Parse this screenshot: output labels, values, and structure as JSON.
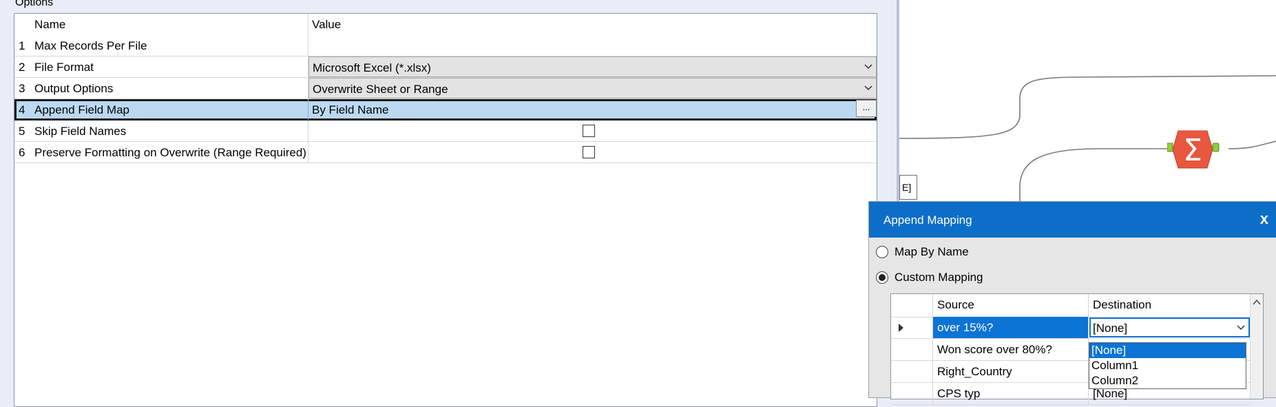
{
  "options": {
    "label": "Options",
    "header": {
      "name": "Name",
      "value": "Value"
    },
    "rows": [
      {
        "index": "1",
        "name": "Max Records Per File",
        "value": ""
      },
      {
        "index": "2",
        "name": "File Format",
        "value": "Microsoft Excel (*.xlsx)"
      },
      {
        "index": "3",
        "name": "Output Options",
        "value": "Overwrite Sheet or Range"
      },
      {
        "index": "4",
        "name": "Append Field Map",
        "value": "By Field Name",
        "button": "..."
      },
      {
        "index": "5",
        "name": "Skip Field Names",
        "checked": false
      },
      {
        "index": "6",
        "name": "Preserve Formatting on Overwrite (Range Required)",
        "checked": false
      }
    ]
  },
  "canvas": {
    "tool_box_text": "E]"
  },
  "append_mapping": {
    "title": "Append Mapping",
    "close_label": "x",
    "radio_map_by_name": "Map By Name",
    "radio_custom_mapping": "Custom Mapping",
    "selected_mode": "Custom Mapping",
    "columns": {
      "source": "Source",
      "destination": "Destination"
    },
    "rows": [
      {
        "source": "over 15%?",
        "destination": "[None]"
      },
      {
        "source": "Won score over 80%?",
        "destination": ""
      },
      {
        "source": "Right_Country",
        "destination": ""
      },
      {
        "source": "CPS typ",
        "destination": "[None]"
      }
    ],
    "dropdown_options": [
      "[None]",
      "Column1",
      "Column2"
    ],
    "highlighted_option": "[None]"
  },
  "colors": {
    "title_bar": "#0d6ec8",
    "selection": "#0c74d4",
    "row_selected": "#bcd9f2"
  }
}
